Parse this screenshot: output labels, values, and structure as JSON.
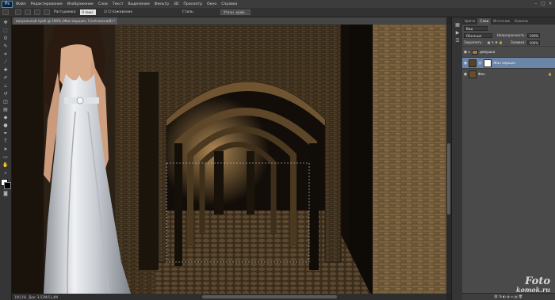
{
  "menubar": {
    "logo": "Ps",
    "items": [
      "Файл",
      "Редактирование",
      "Изображение",
      "Слои",
      "Текст",
      "Выделение",
      "Фильтр",
      "3D",
      "Просмотр",
      "Окно",
      "Справка"
    ]
  },
  "options": {
    "feather_label": "Растушевка:",
    "feather_value": "0 пикс.",
    "antialias_label": "Сглаживание",
    "style_label": "Стиль:",
    "refine_label": "Уточн. край..."
  },
  "document": {
    "tab_title": "визуальный проб @ 100% (Жан вершин, Слой-маска/8) *"
  },
  "status": {
    "zoom": "100,1%",
    "doc_size": "Док: 3,52M/11,4M"
  },
  "panel": {
    "tabs": [
      "Цвета",
      "Слои",
      "Источник",
      "Каналы"
    ],
    "kind_label": "Вид",
    "blend_mode": "Обычные",
    "opacity_label": "Непрозрачность:",
    "opacity_value": "100%",
    "lock_label": "Закрепить:",
    "fill_label": "Заливка:",
    "fill_value": "100%",
    "layers": [
      {
        "name": "девушка",
        "type": "group",
        "selected": false
      },
      {
        "name": "Жан вершин",
        "type": "masked",
        "selected": true
      },
      {
        "name": "Фон",
        "type": "background",
        "selected": false
      }
    ]
  },
  "watermark": {
    "line1": "Foto",
    "line2": "komok.ru"
  }
}
